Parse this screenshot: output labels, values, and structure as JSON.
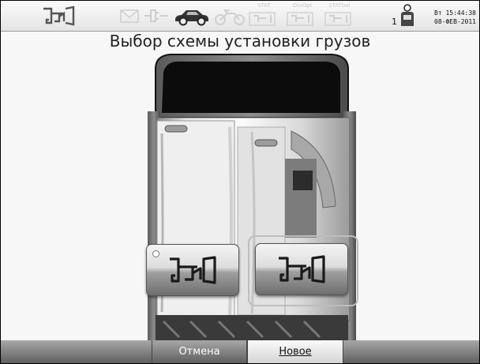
{
  "header": {
    "stat_labels": [
      "STAT",
      "DinOpt",
      "STATbal"
    ],
    "operator_number": "1",
    "datetime_line1": "Вт 15:44:38",
    "datetime_line2": "08-ФЕВ-2011"
  },
  "title": "Выбор схемы установки грузов",
  "schemes": [
    {
      "name": "scheme-weights-left-and-rim"
    },
    {
      "name": "scheme-weights-rim-and-right",
      "selected": true
    }
  ],
  "bottom_bar": {
    "cancel_label": "Отмена",
    "new_label": "Новое"
  }
}
